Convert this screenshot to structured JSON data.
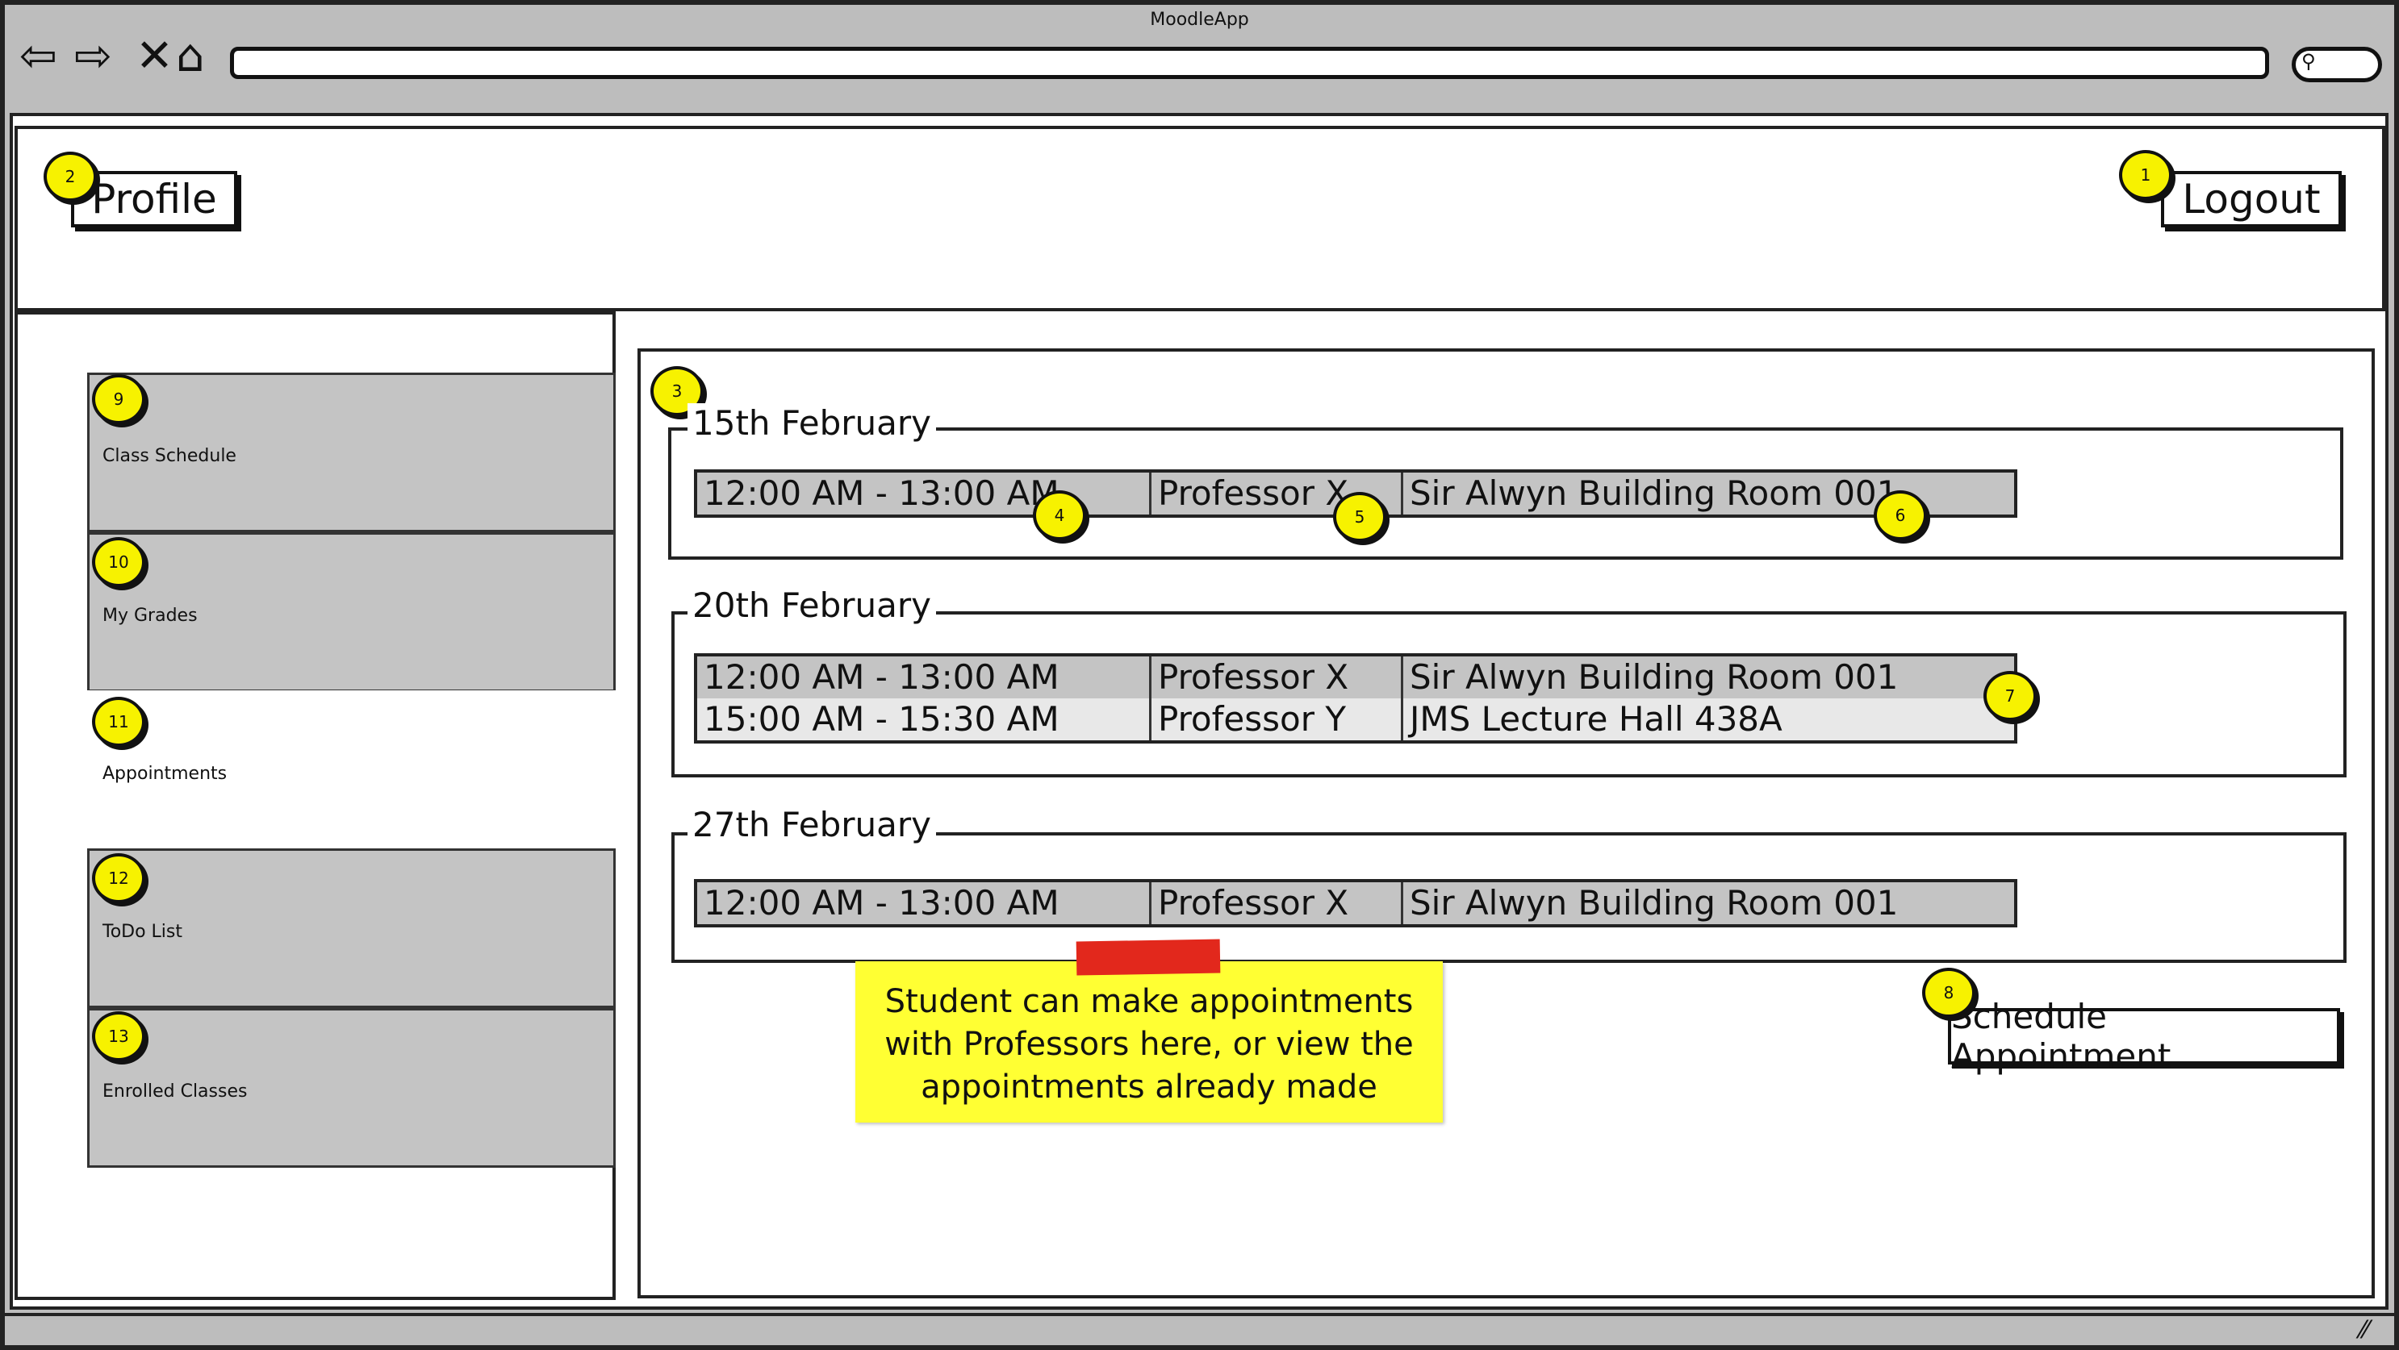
{
  "window": {
    "title": "MoodleApp"
  },
  "header": {
    "profile_label": "Profile",
    "logout_label": "Logout"
  },
  "sidebar": {
    "items": [
      {
        "label": "Class Schedule",
        "marker": "9"
      },
      {
        "label": "My Grades",
        "marker": "10"
      },
      {
        "label": "Appointments",
        "marker": "11"
      },
      {
        "label": "ToDo List",
        "marker": "12"
      },
      {
        "label": "Enrolled Classes",
        "marker": "13"
      }
    ]
  },
  "appointments": {
    "groups": [
      {
        "date": "15th February",
        "rows": [
          {
            "time": "12:00 AM - 13:00 AM",
            "professor": "Professor X",
            "location": "Sir Alwyn Building Room 001"
          }
        ]
      },
      {
        "date": "20th February",
        "rows": [
          {
            "time": "12:00 AM - 13:00 AM",
            "professor": "Professor X",
            "location": "Sir Alwyn Building Room 001"
          },
          {
            "time": "15:00 AM - 15:30 AM",
            "professor": "Professor Y",
            "location": "JMS Lecture Hall 438A"
          }
        ]
      },
      {
        "date": "27th February",
        "rows": [
          {
            "time": "12:00 AM - 13:00 AM",
            "professor": "Professor X",
            "location": "Sir Alwyn Building Room 001"
          }
        ]
      }
    ],
    "schedule_button_label": "Schedule Appointment"
  },
  "markers": {
    "logout": "1",
    "profile": "2",
    "content": "3",
    "time": "4",
    "professor": "5",
    "location": "6",
    "table": "7",
    "schedule": "8"
  },
  "note": {
    "text": "Student can make appointments with Professors here, or view the appointments already made"
  },
  "colors": {
    "highlight": "#f7f200",
    "note": "#ffff33",
    "tape": "#e2281c",
    "selected_row": "#c4c4c4"
  }
}
